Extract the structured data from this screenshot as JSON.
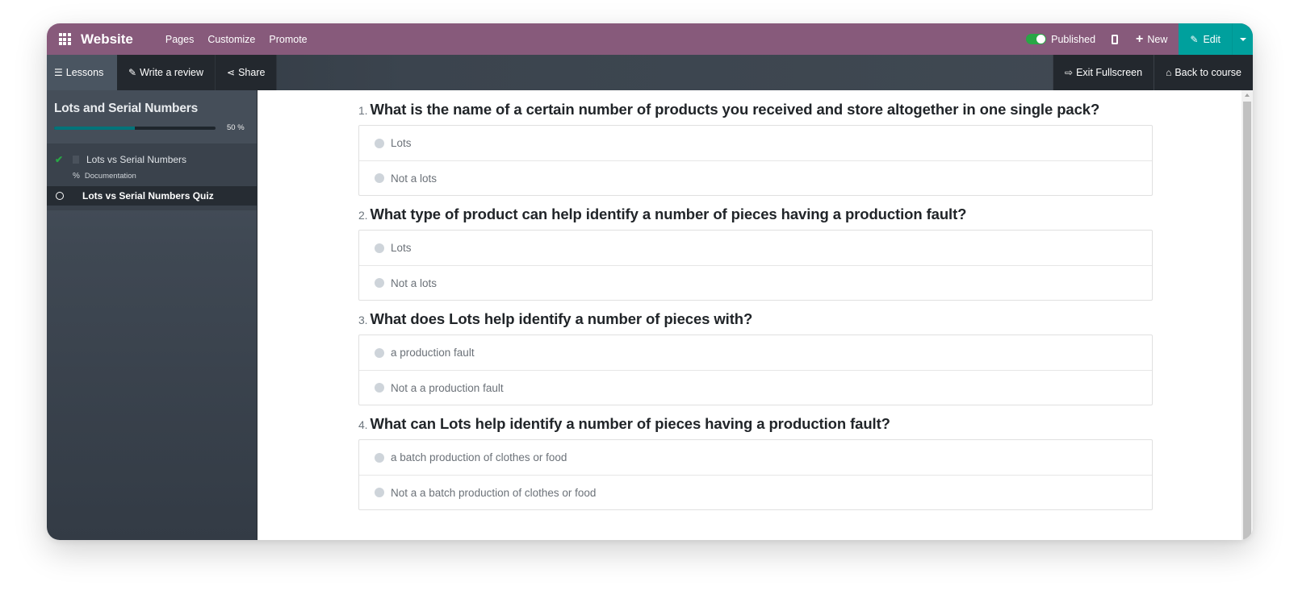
{
  "topbar": {
    "brand": "Website",
    "menu": [
      "Pages",
      "Customize",
      "Promote"
    ],
    "published_label": "Published",
    "published": true,
    "new_label": "New",
    "edit_label": "Edit",
    "colors": {
      "bar": "#875a7b",
      "edit": "#00a09d",
      "toggle_on": "#28a745"
    }
  },
  "subbar": {
    "lessons_label": "Lessons",
    "review_label": "Write a review",
    "share_label": "Share",
    "exit_fullscreen_label": "Exit Fullscreen",
    "back_label": "Back to course"
  },
  "sidebar": {
    "course_title": "Lots and Serial Numbers",
    "progress_percent": 50,
    "progress_label": "50 %",
    "lessons": [
      {
        "title": "Lots vs Serial Numbers",
        "completed": true,
        "resource": "Documentation"
      },
      {
        "title": "Lots vs Serial Numbers Quiz",
        "completed": false,
        "active": true
      }
    ]
  },
  "quiz": {
    "questions": [
      {
        "number": "1.",
        "text": "What is the name of a certain number of products you received and store altogether in one single pack?",
        "answers": [
          "Lots",
          "Not a lots"
        ]
      },
      {
        "number": "2.",
        "text": "What type of product can help identify a number of pieces having a production fault?",
        "answers": [
          "Lots",
          "Not a lots"
        ]
      },
      {
        "number": "3.",
        "text": "What does Lots help identify a number of pieces with?",
        "answers": [
          "a production fault",
          "Not a a production fault"
        ]
      },
      {
        "number": "4.",
        "text": "What can Lots help identify a number of pieces having a production fault?",
        "answers": [
          "a batch production of clothes or food",
          "Not a a batch production of clothes or food"
        ]
      }
    ]
  }
}
